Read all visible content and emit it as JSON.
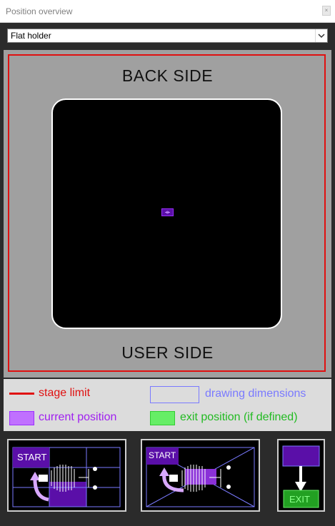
{
  "window": {
    "title": "Position overview"
  },
  "holder_select": {
    "selected": "Flat holder"
  },
  "stage": {
    "back_label": "BACK SIDE",
    "user_label": "USER SIDE"
  },
  "legend": {
    "stage_limit": "stage limit",
    "drawing_dimensions": "drawing dimensions",
    "current_position": "current position",
    "exit_position": "exit position (if defined)"
  },
  "thumbnails": {
    "start_label": "START",
    "exit_label": "EXIT"
  },
  "colors": {
    "stage_limit": "#e01010",
    "drawing_dimensions": "#7a7aff",
    "current_position": "#b266ff",
    "exit_position": "#33cc33"
  }
}
